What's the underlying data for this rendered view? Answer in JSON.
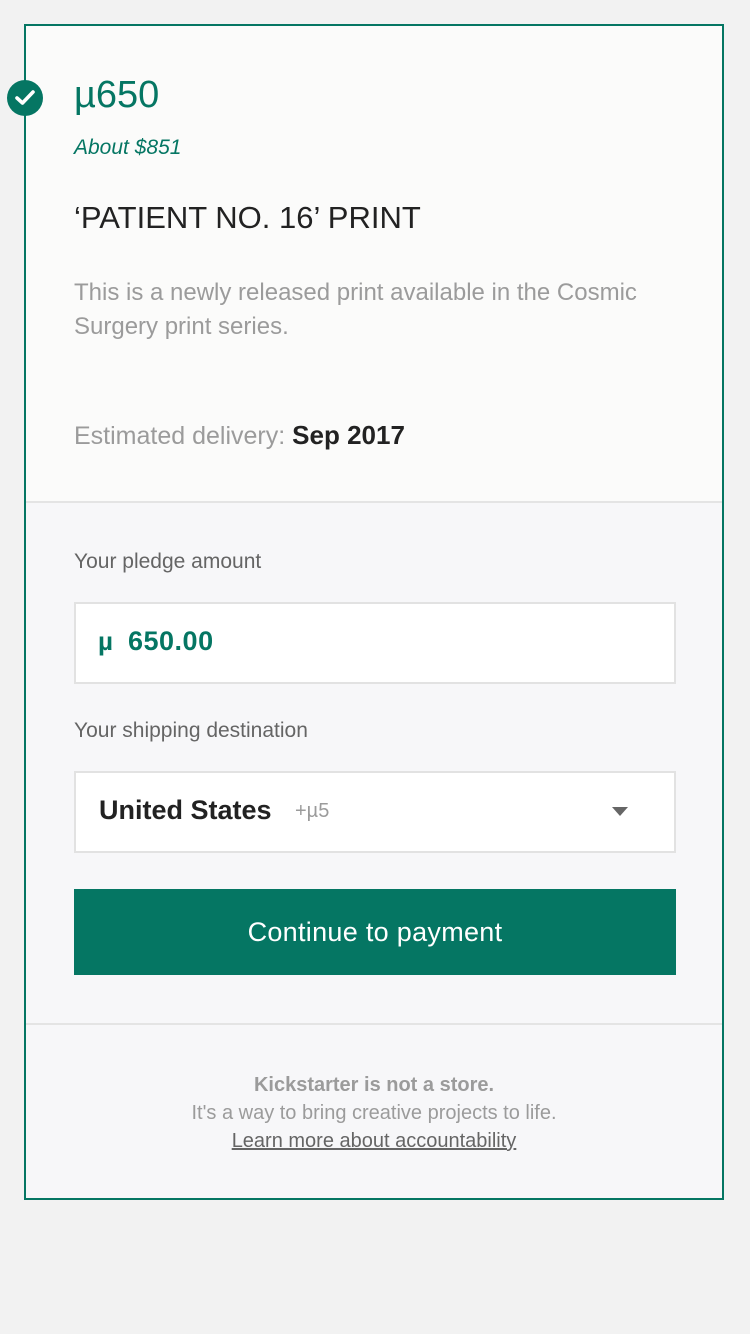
{
  "reward": {
    "amount": "µ650",
    "about": "About $851",
    "title": "‘PATIENT NO. 16’ PRINT",
    "description": "This is a newly released print available in the Cosmic Surgery print series.",
    "delivery_label": "Estimated delivery:",
    "delivery_date": "Sep 2017",
    "selected_icon": "check-icon"
  },
  "pledge": {
    "label": "Your pledge amount",
    "currency": "µ",
    "value": "650.00"
  },
  "shipping": {
    "label": "Your shipping destination",
    "selected": "United States",
    "cost": "+µ5"
  },
  "cta": {
    "label": "Continue to payment"
  },
  "footer": {
    "strong": "Kickstarter is not a store.",
    "line": "It's a way to bring creative projects to life.",
    "link": "Learn more about accountability"
  },
  "colors": {
    "accent": "#057663",
    "background": "#f2f2f2"
  }
}
